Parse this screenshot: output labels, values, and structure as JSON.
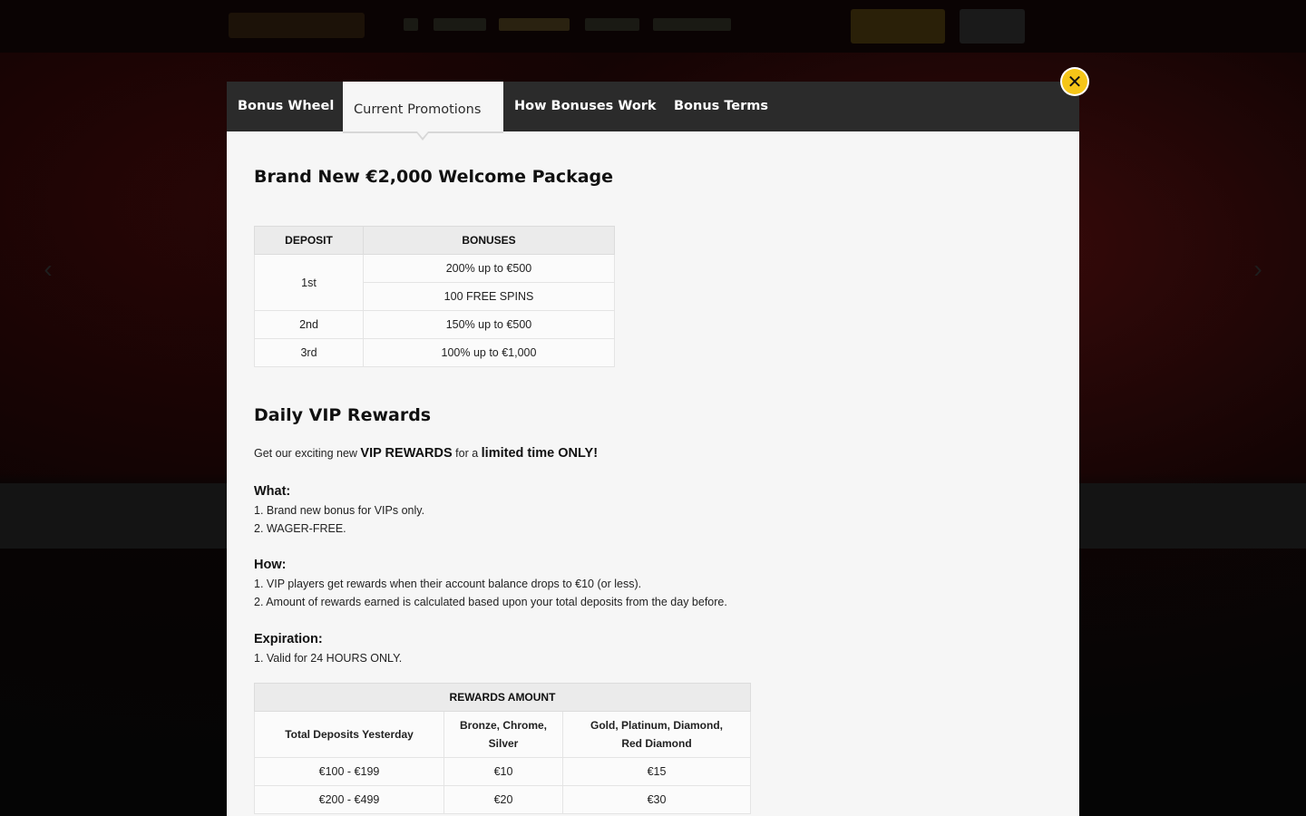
{
  "tabs": [
    {
      "label": "Bonus Wheel"
    },
    {
      "label": "Current Promotions"
    },
    {
      "label": "How Bonuses Work"
    },
    {
      "label": "Bonus Terms"
    }
  ],
  "close_icon": "close-icon",
  "welcome": {
    "title": "Brand New €2,000 Welcome Package",
    "headers": [
      "DEPOSIT",
      "BONUSES"
    ],
    "rows": [
      {
        "deposit": "1st",
        "bonuses": [
          "200% up to €500",
          "100 FREE SPINS"
        ]
      },
      {
        "deposit": "2nd",
        "bonuses": [
          "150% up to €500"
        ]
      },
      {
        "deposit": "3rd",
        "bonuses": [
          "100% up to €1,000"
        ]
      }
    ]
  },
  "vip": {
    "title": "Daily VIP Rewards",
    "intro_prefix": "Get our exciting new ",
    "intro_highlight": "VIP REWARDS",
    "intro_middle": " for a ",
    "intro_emphasis": "limited time ONLY!",
    "what_label": "What:",
    "what_items": [
      "1. Brand new bonus for VIPs only.",
      "2. WAGER-FREE."
    ],
    "how_label": "How:",
    "how_items": [
      "1. VIP players get rewards when their account balance drops to €10 (or less).",
      "2. Amount of rewards earned is calculated based upon your total deposits from the day before."
    ],
    "expiration_label": "Expiration:",
    "expiration_items": [
      "1. Valid for 24 HOURS ONLY."
    ]
  },
  "rewards": {
    "title": "REWARDS AMOUNT",
    "col1": "Total Deposits Yesterday",
    "col2_line1": "Bronze, Chrome,",
    "col2_line2": "Silver",
    "col3_line1": "Gold, Platinum, Diamond,",
    "col3_line2": "Red Diamond",
    "rows": [
      {
        "range": "€100 - €199",
        "low": "€10",
        "high": "€15"
      },
      {
        "range": "€200 - €499",
        "low": "€20",
        "high": "€30"
      }
    ]
  },
  "colors": {
    "accent": "#f5c518",
    "tabbar": "#2b2b2b",
    "panel": "#f6f6f6"
  }
}
